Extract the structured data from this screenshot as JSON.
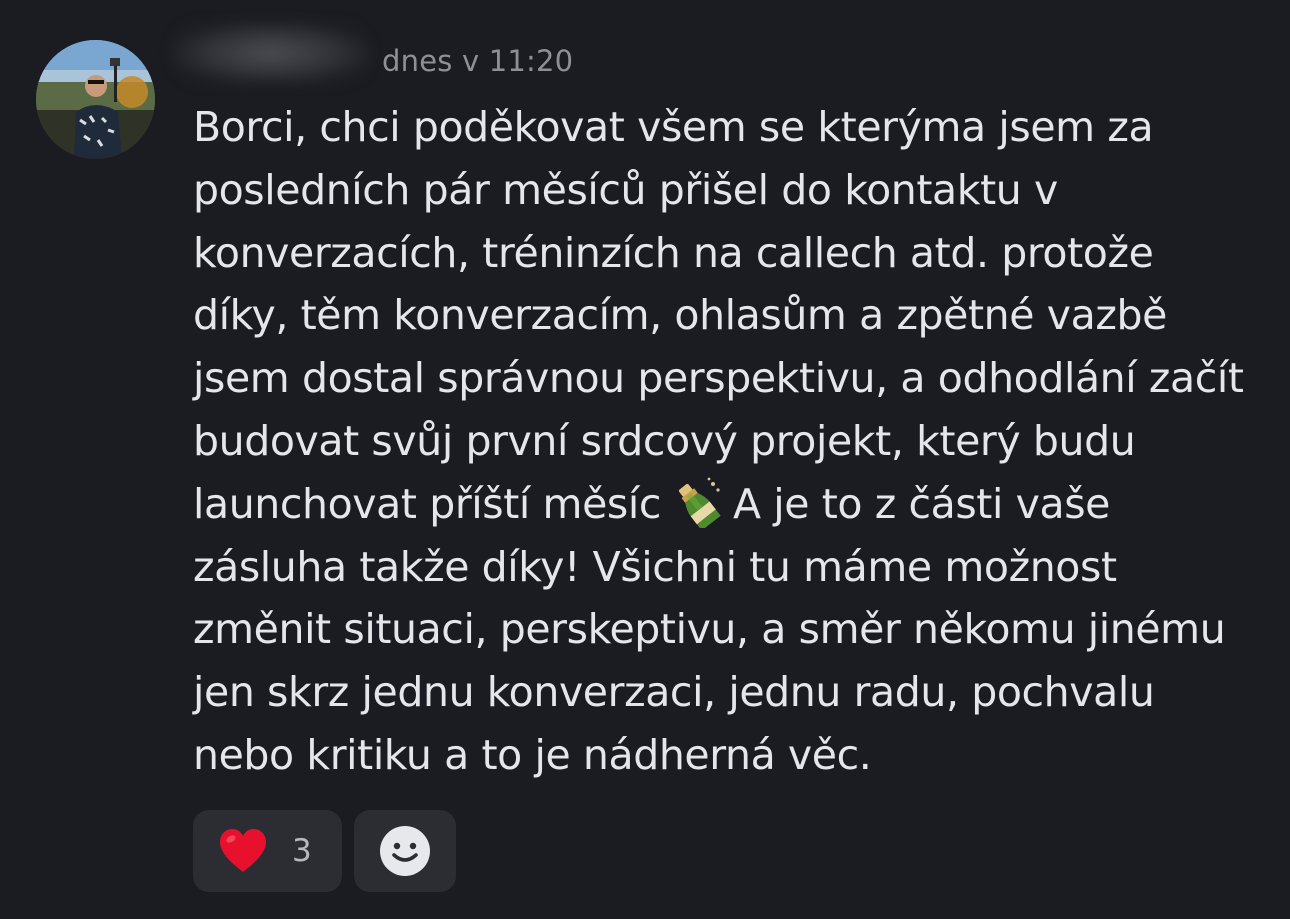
{
  "message": {
    "timestamp": "dnes v 11:20",
    "avatar_icon": "user-avatar-photo",
    "lines": [
      "Borci, chci poděkovat všem se kterýma jsem za",
      "posledních pár měsíců přišel do kontaktu v",
      "konverzacích, tréninzích na callech atd. protože",
      "díky, těm konverzacím, ohlasům a zpětné vazbě",
      "jsem dostal správnou perspektivu, a odhodlání začít",
      "budovat svůj první srdcový projekt, který budu",
      "launchovat příští měsíc",
      "A je to z části vaše",
      "zásluha takže díky! Všichni tu máme možnost",
      "změnit situaci, perskeptivu, a směr někomu jinému",
      "jen skrz jednu konverzaci, jednu radu, pochvalu",
      "nebo kritiku a to je nádherná věc."
    ],
    "inline_emoji": "champagne-bottle-emoji"
  },
  "reactions": [
    {
      "emoji": "red-heart-emoji",
      "count": "3"
    },
    {
      "icon": "add-reaction-smile-icon"
    }
  ],
  "colors": {
    "background": "#1b1c21",
    "text": "#e5e6ea",
    "muted": "#8e9097",
    "reaction_bg": "#2c2d33",
    "heart": "#e8112d"
  }
}
